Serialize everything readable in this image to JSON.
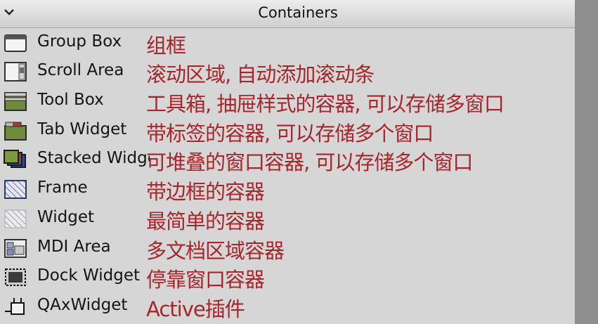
{
  "header": {
    "title": "Containers",
    "collapse_icon": "chevron-down-icon"
  },
  "items": [
    {
      "label": "Group Box",
      "note": "组框",
      "icon": "group-box-icon"
    },
    {
      "label": "Scroll Area",
      "note": "滚动区域, 自动添加滚动条",
      "icon": "scroll-area-icon"
    },
    {
      "label": "Tool Box",
      "note": "工具箱, 抽屉样式的容器, 可以存储多窗口",
      "icon": "tool-box-icon"
    },
    {
      "label": "Tab Widget",
      "note": "带标签的容器, 可以存储多个窗口",
      "icon": "tab-widget-icon"
    },
    {
      "label": "Stacked Widget",
      "note": "可堆叠的窗口容器, 可以存储多个窗口",
      "icon": "stacked-widget-icon"
    },
    {
      "label": "Frame",
      "note": "带边框的容器",
      "icon": "frame-icon"
    },
    {
      "label": "Widget",
      "note": "最简单的容器",
      "icon": "widget-icon"
    },
    {
      "label": "MDI Area",
      "note": "多文档区域容器",
      "icon": "mdi-area-icon"
    },
    {
      "label": "Dock Widget",
      "note": "停靠窗口容器",
      "icon": "dock-widget-icon"
    },
    {
      "label": "QAxWidget",
      "note": "Active插件",
      "icon": "qaxwidget-icon"
    }
  ]
}
